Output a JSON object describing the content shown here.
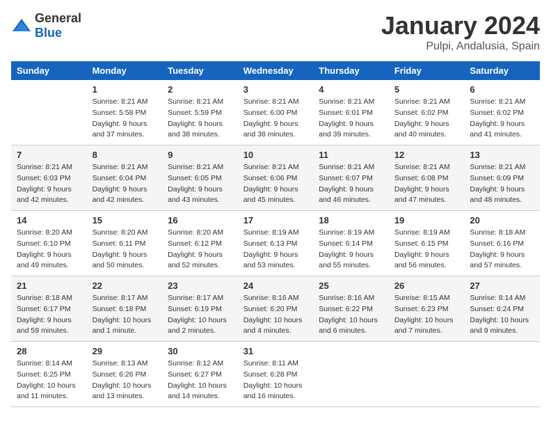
{
  "header": {
    "logo_general": "General",
    "logo_blue": "Blue",
    "title": "January 2024",
    "subtitle": "Pulpi, Andalusia, Spain"
  },
  "days_of_week": [
    "Sunday",
    "Monday",
    "Tuesday",
    "Wednesday",
    "Thursday",
    "Friday",
    "Saturday"
  ],
  "weeks": [
    [
      {
        "day": "",
        "info": []
      },
      {
        "day": "1",
        "info": [
          "Sunrise: 8:21 AM",
          "Sunset: 5:58 PM",
          "Daylight: 9 hours",
          "and 37 minutes."
        ]
      },
      {
        "day": "2",
        "info": [
          "Sunrise: 8:21 AM",
          "Sunset: 5:59 PM",
          "Daylight: 9 hours",
          "and 38 minutes."
        ]
      },
      {
        "day": "3",
        "info": [
          "Sunrise: 8:21 AM",
          "Sunset: 6:00 PM",
          "Daylight: 9 hours",
          "and 38 minutes."
        ]
      },
      {
        "day": "4",
        "info": [
          "Sunrise: 8:21 AM",
          "Sunset: 6:01 PM",
          "Daylight: 9 hours",
          "and 39 minutes."
        ]
      },
      {
        "day": "5",
        "info": [
          "Sunrise: 8:21 AM",
          "Sunset: 6:02 PM",
          "Daylight: 9 hours",
          "and 40 minutes."
        ]
      },
      {
        "day": "6",
        "info": [
          "Sunrise: 8:21 AM",
          "Sunset: 6:02 PM",
          "Daylight: 9 hours",
          "and 41 minutes."
        ]
      }
    ],
    [
      {
        "day": "7",
        "info": [
          "Sunrise: 8:21 AM",
          "Sunset: 6:03 PM",
          "Daylight: 9 hours",
          "and 42 minutes."
        ]
      },
      {
        "day": "8",
        "info": [
          "Sunrise: 8:21 AM",
          "Sunset: 6:04 PM",
          "Daylight: 9 hours",
          "and 42 minutes."
        ]
      },
      {
        "day": "9",
        "info": [
          "Sunrise: 8:21 AM",
          "Sunset: 6:05 PM",
          "Daylight: 9 hours",
          "and 43 minutes."
        ]
      },
      {
        "day": "10",
        "info": [
          "Sunrise: 8:21 AM",
          "Sunset: 6:06 PM",
          "Daylight: 9 hours",
          "and 45 minutes."
        ]
      },
      {
        "day": "11",
        "info": [
          "Sunrise: 8:21 AM",
          "Sunset: 6:07 PM",
          "Daylight: 9 hours",
          "and 46 minutes."
        ]
      },
      {
        "day": "12",
        "info": [
          "Sunrise: 8:21 AM",
          "Sunset: 6:08 PM",
          "Daylight: 9 hours",
          "and 47 minutes."
        ]
      },
      {
        "day": "13",
        "info": [
          "Sunrise: 8:21 AM",
          "Sunset: 6:09 PM",
          "Daylight: 9 hours",
          "and 48 minutes."
        ]
      }
    ],
    [
      {
        "day": "14",
        "info": [
          "Sunrise: 8:20 AM",
          "Sunset: 6:10 PM",
          "Daylight: 9 hours",
          "and 49 minutes."
        ]
      },
      {
        "day": "15",
        "info": [
          "Sunrise: 8:20 AM",
          "Sunset: 6:11 PM",
          "Daylight: 9 hours",
          "and 50 minutes."
        ]
      },
      {
        "day": "16",
        "info": [
          "Sunrise: 8:20 AM",
          "Sunset: 6:12 PM",
          "Daylight: 9 hours",
          "and 52 minutes."
        ]
      },
      {
        "day": "17",
        "info": [
          "Sunrise: 8:19 AM",
          "Sunset: 6:13 PM",
          "Daylight: 9 hours",
          "and 53 minutes."
        ]
      },
      {
        "day": "18",
        "info": [
          "Sunrise: 8:19 AM",
          "Sunset: 6:14 PM",
          "Daylight: 9 hours",
          "and 55 minutes."
        ]
      },
      {
        "day": "19",
        "info": [
          "Sunrise: 8:19 AM",
          "Sunset: 6:15 PM",
          "Daylight: 9 hours",
          "and 56 minutes."
        ]
      },
      {
        "day": "20",
        "info": [
          "Sunrise: 8:18 AM",
          "Sunset: 6:16 PM",
          "Daylight: 9 hours",
          "and 57 minutes."
        ]
      }
    ],
    [
      {
        "day": "21",
        "info": [
          "Sunrise: 8:18 AM",
          "Sunset: 6:17 PM",
          "Daylight: 9 hours",
          "and 59 minutes."
        ]
      },
      {
        "day": "22",
        "info": [
          "Sunrise: 8:17 AM",
          "Sunset: 6:18 PM",
          "Daylight: 10 hours",
          "and 1 minute."
        ]
      },
      {
        "day": "23",
        "info": [
          "Sunrise: 8:17 AM",
          "Sunset: 6:19 PM",
          "Daylight: 10 hours",
          "and 2 minutes."
        ]
      },
      {
        "day": "24",
        "info": [
          "Sunrise: 8:16 AM",
          "Sunset: 6:20 PM",
          "Daylight: 10 hours",
          "and 4 minutes."
        ]
      },
      {
        "day": "25",
        "info": [
          "Sunrise: 8:16 AM",
          "Sunset: 6:22 PM",
          "Daylight: 10 hours",
          "and 6 minutes."
        ]
      },
      {
        "day": "26",
        "info": [
          "Sunrise: 8:15 AM",
          "Sunset: 6:23 PM",
          "Daylight: 10 hours",
          "and 7 minutes."
        ]
      },
      {
        "day": "27",
        "info": [
          "Sunrise: 8:14 AM",
          "Sunset: 6:24 PM",
          "Daylight: 10 hours",
          "and 9 minutes."
        ]
      }
    ],
    [
      {
        "day": "28",
        "info": [
          "Sunrise: 8:14 AM",
          "Sunset: 6:25 PM",
          "Daylight: 10 hours",
          "and 11 minutes."
        ]
      },
      {
        "day": "29",
        "info": [
          "Sunrise: 8:13 AM",
          "Sunset: 6:26 PM",
          "Daylight: 10 hours",
          "and 13 minutes."
        ]
      },
      {
        "day": "30",
        "info": [
          "Sunrise: 8:12 AM",
          "Sunset: 6:27 PM",
          "Daylight: 10 hours",
          "and 14 minutes."
        ]
      },
      {
        "day": "31",
        "info": [
          "Sunrise: 8:11 AM",
          "Sunset: 6:28 PM",
          "Daylight: 10 hours",
          "and 16 minutes."
        ]
      },
      {
        "day": "",
        "info": []
      },
      {
        "day": "",
        "info": []
      },
      {
        "day": "",
        "info": []
      }
    ]
  ]
}
